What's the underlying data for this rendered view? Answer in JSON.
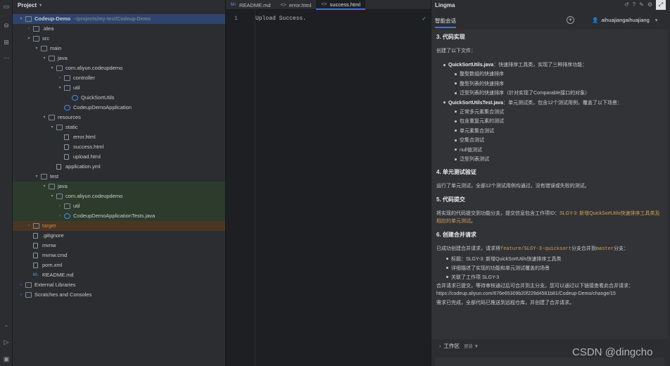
{
  "project": {
    "title": "Project",
    "tree": [
      {
        "label": "Codeup-Demo",
        "hint": "~/projects/my-test/Codeup-Demo",
        "bold": true
      },
      {
        "label": ".idea"
      },
      {
        "label": "src"
      },
      {
        "label": "main"
      },
      {
        "label": "java"
      },
      {
        "label": "com.aliyun.codeupdemo"
      },
      {
        "label": "controller"
      },
      {
        "label": "util"
      },
      {
        "label": "QuickSortUtils"
      },
      {
        "label": "CodeupDemoApplication"
      },
      {
        "label": "resources"
      },
      {
        "label": "static"
      },
      {
        "label": "error.html"
      },
      {
        "label": "success.html"
      },
      {
        "label": "upload.html"
      },
      {
        "label": "application.yml"
      },
      {
        "label": "test"
      },
      {
        "label": "java"
      },
      {
        "label": "com.aliyun.codeupdemo"
      },
      {
        "label": "util"
      },
      {
        "label": "CodeupDemoApplicationTests.java"
      },
      {
        "label": "target"
      },
      {
        "label": ".gitignore"
      },
      {
        "label": "mvnw"
      },
      {
        "label": "mvnw.cmd"
      },
      {
        "label": "pom.xml"
      },
      {
        "label": "README.md"
      },
      {
        "label": "External Libraries"
      },
      {
        "label": "Scratches and Consoles"
      }
    ]
  },
  "editor": {
    "tabs": [
      {
        "icon": "M↓",
        "label": "README.md"
      },
      {
        "icon": "<>",
        "label": "error.html"
      },
      {
        "icon": "<>",
        "label": "success.html"
      }
    ],
    "line_number": "1",
    "code": "Upload Success."
  },
  "lingma": {
    "title": "Lingma",
    "tab": "智能会话",
    "user": "aihuajiangaihuajiang",
    "s3_title": "3. 代码实现",
    "s3_intro": "创建了以下文件：",
    "f1_name": "QuickSortUtils.java",
    "f1_desc": "：快速排序工具类，实现了三种排序功能：",
    "f1_items": [
      "整型数组的快速排序",
      "整型列表的快速排序",
      "泛型列表的快速排序（针对实现了Comparable接口的对象）"
    ],
    "f2_name": "QuickSortUtilsTest.java",
    "f2_desc": "：单元测试类，包含12个测试用例，覆盖了以下场景：",
    "f2_items": [
      "正常多元素集合测试",
      "包含重复元素的测试",
      "单元素集合测试",
      "空集合测试",
      "null值测试",
      "泛型列表测试"
    ],
    "s4_title": "4. 单元测试验证",
    "s4_text": "运行了单元测试，全部12个测试用例均通过，没有错误或失败的测试。",
    "s5_title": "5. 代码提交",
    "s5_pre": "将实现的代码提交到功能分支，提交信息包含工作项ID：",
    "s5_code": "SLGY-3: 新增QuickSortUtils快速排序工具类及相应的单元测试",
    "s5_post": "。",
    "s6_title": "6. 创建合并请求",
    "s6_pre": "已成功创建合并请求，请求将",
    "s6_branch": "feature/SLGY-3-quicksort",
    "s6_mid": "分支合并到",
    "s6_target": "master",
    "s6_post": "分支：",
    "s6_items": [
      "标题：SLGY-3: 新增QuickSortUtils快速排序工具类",
      "详细描述了实现的功能和单元测试覆盖的场景",
      "关联了工作项 SLGY-3"
    ],
    "s6_note": "合并请求已提交，等待审核通过后可合并到主分支。您可以通过以下链接查看此合并请求：",
    "s6_link": "https://codeup.aliyun.com/676e65309b20f229d4581b81/Codeup-Demo/change/15",
    "s6_done": "需求已完成，全部代码已推送到远程仓库，并创建了合并请求。",
    "workspace": "工作区",
    "workspace_sub": "更新",
    "watermark": "CSDN @dingcho"
  }
}
